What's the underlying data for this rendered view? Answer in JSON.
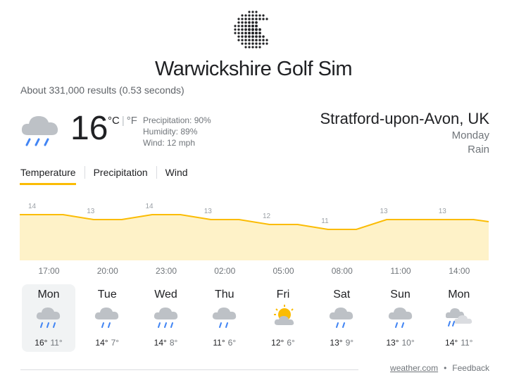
{
  "logo": {
    "text": "Warwickshire Golf Sim"
  },
  "results_count": "About 331,000 results (0.53 seconds)",
  "current": {
    "temp": "16",
    "unit_c": "°C",
    "unit_f": "°F",
    "precipitation": "Precipitation: 90%",
    "humidity": "Humidity: 89%",
    "wind": "Wind: 12 mph",
    "icon": "rain-icon"
  },
  "location": {
    "name": "Stratford-upon-Avon, UK",
    "day": "Monday",
    "condition": "Rain"
  },
  "tabs": [
    {
      "label": "Temperature",
      "active": true
    },
    {
      "label": "Precipitation",
      "active": false
    },
    {
      "label": "Wind",
      "active": false
    }
  ],
  "chart_data": {
    "type": "area",
    "x": [
      "17:00",
      "20:00",
      "23:00",
      "02:00",
      "05:00",
      "08:00",
      "11:00",
      "14:00"
    ],
    "series": [
      {
        "values": [
          14,
          13,
          14,
          13,
          12,
          11,
          13,
          13
        ]
      }
    ],
    "labels": [
      "14",
      "13",
      "14",
      "13",
      "12",
      "11",
      "13",
      "13"
    ],
    "colors": {
      "line": "#fbbc04",
      "fill": "#fef2c8",
      "label": "#9aa0a6"
    }
  },
  "forecast": [
    {
      "day": "Mon",
      "hi": "16°",
      "lo": "11°",
      "icon": "rain-icon"
    },
    {
      "day": "Tue",
      "hi": "14°",
      "lo": "7°",
      "icon": "light-rain-icon"
    },
    {
      "day": "Wed",
      "hi": "14°",
      "lo": "8°",
      "icon": "rain-icon"
    },
    {
      "day": "Thu",
      "hi": "11°",
      "lo": "6°",
      "icon": "light-rain-icon"
    },
    {
      "day": "Fri",
      "hi": "12°",
      "lo": "6°",
      "icon": "partly-cloudy-icon"
    },
    {
      "day": "Sat",
      "hi": "13°",
      "lo": "9°",
      "icon": "light-rain-icon"
    },
    {
      "day": "Sun",
      "hi": "13°",
      "lo": "10°",
      "icon": "light-rain-icon"
    },
    {
      "day": "Mon",
      "hi": "14°",
      "lo": "11°",
      "icon": "rain-and-cloud-icon"
    }
  ],
  "footer": {
    "source": "weather.com",
    "feedback": "Feedback"
  }
}
